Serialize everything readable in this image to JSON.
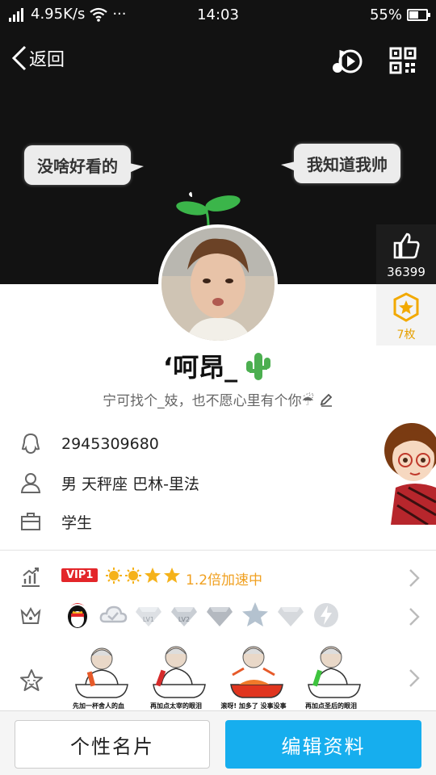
{
  "status": {
    "speed": "4.95K/s",
    "dots": "···",
    "time": "14:03",
    "battery": "55%",
    "battery_level": 0.55
  },
  "topbar": {
    "back_label": "返回"
  },
  "cover": {
    "bubble_left": "没啥好看的",
    "bubble_right": "我知道我帅"
  },
  "side": {
    "like_count": "36399",
    "medal_count": "7枚"
  },
  "profile": {
    "nickname": "‘呵昂_",
    "nickname_emoji": "🌵",
    "signature": "宁可找个_妓，也不愿心里有个你☔"
  },
  "info": {
    "qq_number": "2945309680",
    "basic": "男  天秤座  巴林-里法",
    "job": "学生"
  },
  "vip": {
    "badge": "VIP1",
    "text": "1.2倍加速中"
  },
  "badges": {
    "items": [
      "qq-penguin",
      "cloud",
      "LV1",
      "LV2",
      "diamond",
      "star",
      "diamond",
      "lightning"
    ]
  },
  "emoji": {
    "captions": [
      "先加一杯舍人的血",
      "再加点太宰的眼泪",
      "滚呀! 加多了 没事没事",
      "再加点圣后的眼泪"
    ]
  },
  "buttons": {
    "card_label": "个性名片",
    "edit_label": "编辑资料"
  },
  "colors": {
    "accent": "#16aeee",
    "vip_red": "#e3262a",
    "vip_gold": "#f0a020"
  }
}
